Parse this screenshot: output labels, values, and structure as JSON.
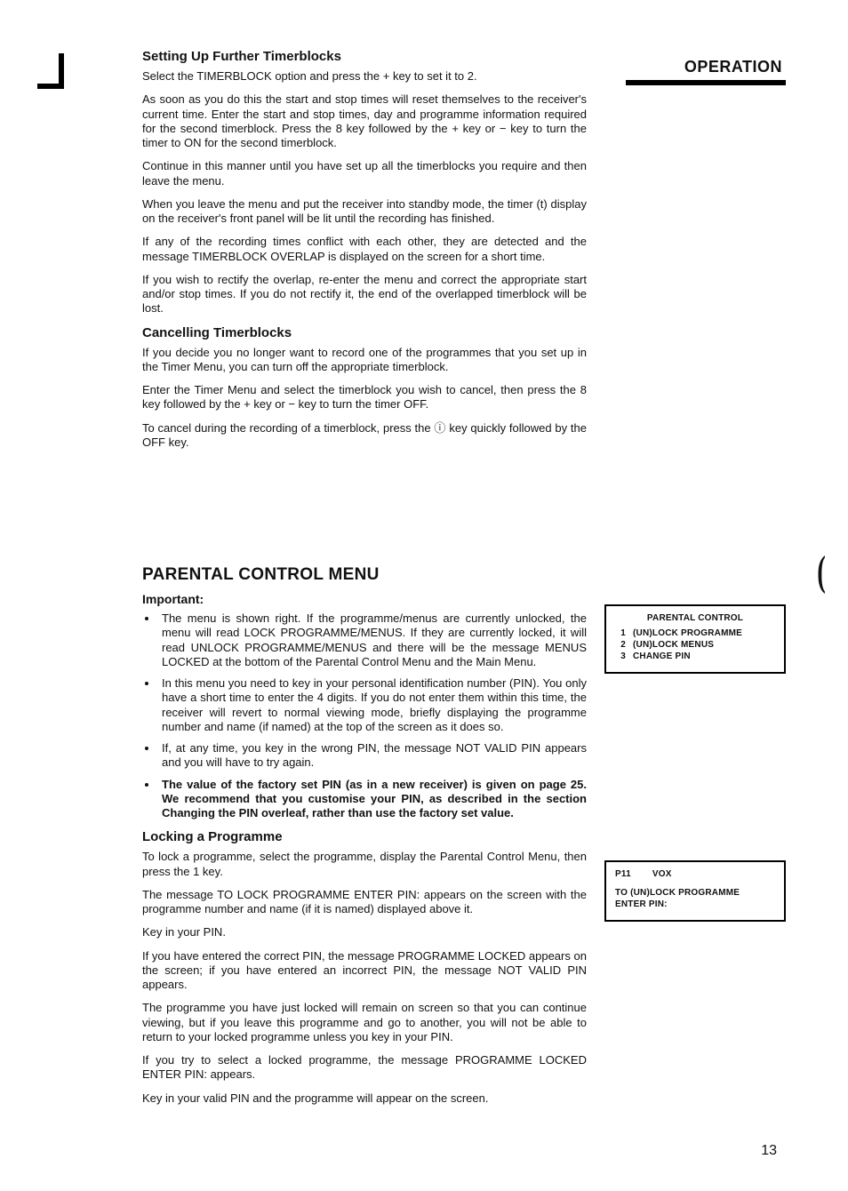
{
  "sideHeader": "OPERATION",
  "pageNumber": "13",
  "section1": {
    "heading": "Setting Up Further Timerblocks",
    "p1": "Select the TIMERBLOCK option and press the + key to set it to 2.",
    "p2": "As soon as you do this the start and stop times will reset themselves to the receiver's current time. Enter the start and stop times, day and programme information required for the second timerblock. Press the 8 key followed by the + key or − key to turn the timer to ON for the second timerblock.",
    "p3": "Continue in this manner until you have set up all the timerblocks you require and then leave the menu.",
    "p4": "When you leave the menu and put the receiver into standby mode, the timer (t) display on the receiver's front panel will be lit until the recording has finished.",
    "p5": "If any of the recording times conflict with each other, they are detected and the message TIMERBLOCK OVERLAP is displayed on the screen for a short time.",
    "p6": "If you wish to rectify the overlap, re-enter the menu and correct the appropriate start and/or stop times. If you do not rectify it, the end of the overlapped timerblock will be lost."
  },
  "section2": {
    "heading": "Cancelling Timerblocks",
    "p1": "If you decide you no longer want to record one of the programmes that you set up in the Timer Menu, you can turn off the appropriate timerblock.",
    "p2": "Enter the Timer Menu and select the timerblock you wish to cancel, then press the 8 key followed by the + key or − key to turn the timer OFF.",
    "p3": "To cancel during the recording of a timerblock, press the ⓘ key quickly followed by the OFF key."
  },
  "section3": {
    "heading": "PARENTAL CONTROL MENU",
    "importantLabel": "Important:",
    "bullets": [
      "The menu is shown right. If the programme/menus are currently unlocked, the menu will read LOCK PROGRAMME/MENUS. If they are currently locked, it will read UNLOCK PROGRAMME/MENUS and there will be the message MENUS LOCKED at the bottom of the Parental Control Menu and the Main Menu.",
      "In this menu you need to key in your personal identification number (PIN). You only have a short time to enter the 4 digits. If you do not enter them within this time, the receiver will revert to normal viewing mode, briefly displaying the programme number and name (if named) at the top of the screen as it does so.",
      "If, at any time, you key in the wrong PIN, the message NOT VALID PIN appears and you will have to try again.",
      "The value of the factory set PIN (as in a new receiver) is given on page 25. We recommend that you customise your PIN, as described in the section Changing the PIN overleaf, rather than use the factory set value."
    ]
  },
  "section4": {
    "heading": "Locking a Programme",
    "p1": "To lock a programme, select the programme, display the Parental Control Menu, then press the 1 key.",
    "p2": "The message TO LOCK PROGRAMME ENTER PIN: appears on the screen with the programme number and name (if it is named) displayed above it.",
    "p3": "Key in your PIN.",
    "p4": "If you have entered the correct PIN, the message PROGRAMME LOCKED appears on the screen; if you have entered an incorrect PIN, the message NOT VALID PIN appears.",
    "p5": "The programme you have just locked will remain on screen so that you can continue viewing, but if you leave this programme and go to another, you will not be able to return to your locked programme unless you key in your PIN.",
    "p6": "If you try to select a locked programme, the message PROGRAMME LOCKED ENTER PIN: appears.",
    "p7": "Key in your valid PIN and the programme will appear on the screen."
  },
  "osd1": {
    "title": "PARENTAL CONTROL",
    "items": [
      {
        "n": "1",
        "t": "(UN)LOCK PROGRAMME"
      },
      {
        "n": "2",
        "t": "(UN)LOCK MENUS"
      },
      {
        "n": "3",
        "t": "CHANGE PIN"
      }
    ]
  },
  "osd2": {
    "prog": "P11",
    "name": "VOX",
    "line1": "TO (UN)LOCK PROGRAMME",
    "line2": "ENTER PIN:"
  }
}
